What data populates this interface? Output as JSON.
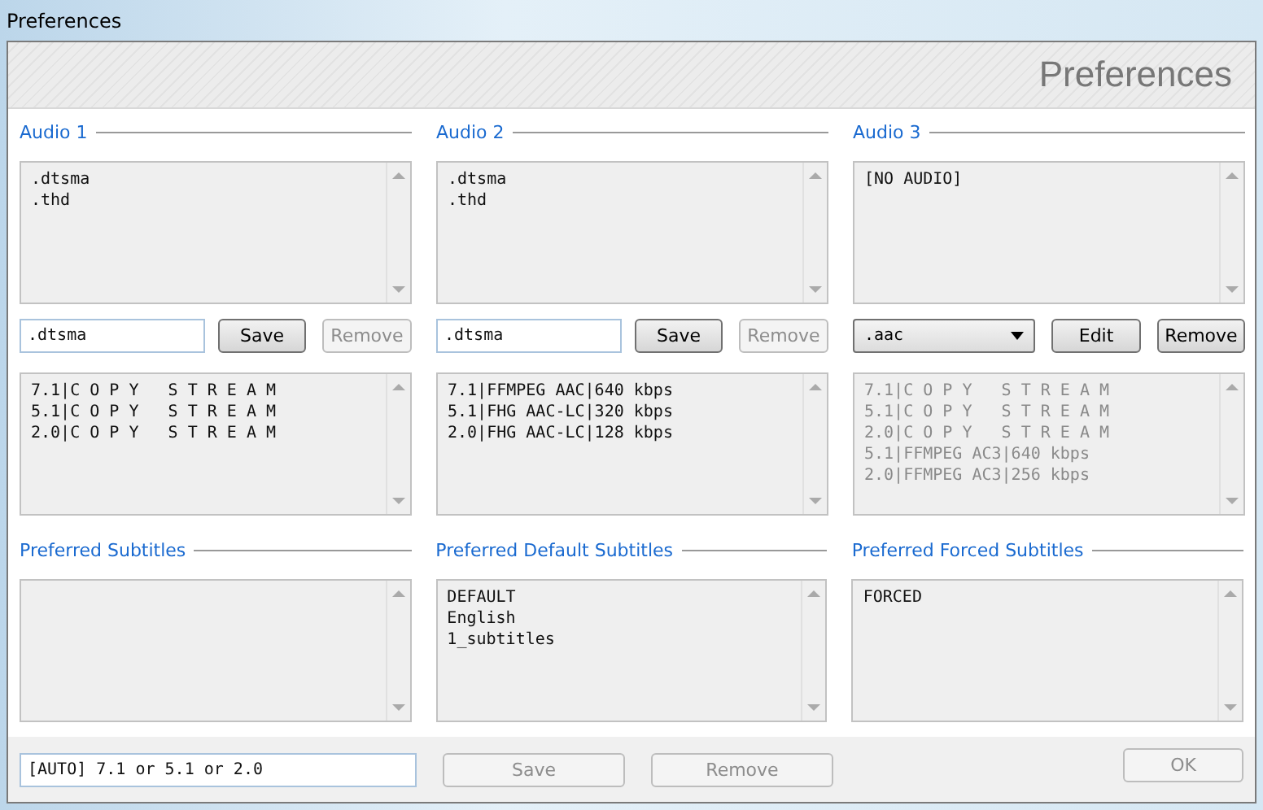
{
  "window": {
    "title": "Preferences"
  },
  "header": {
    "title": "Preferences"
  },
  "audio_sections": [
    {
      "heading": "Audio 1",
      "extensions": [
        ".dtsma",
        ".thd"
      ],
      "selector": {
        "kind": "field",
        "value": ".dtsma"
      },
      "buttons": [
        {
          "label": "Save",
          "disabled": false
        },
        {
          "label": "Remove",
          "disabled": true
        }
      ],
      "codecs": {
        "disabled": false,
        "lines": [
          "7.1|C O P Y   S T R E A M",
          "5.1|C O P Y   S T R E A M",
          "2.0|C O P Y   S T R E A M"
        ]
      }
    },
    {
      "heading": "Audio 2",
      "extensions": [
        ".dtsma",
        ".thd"
      ],
      "selector": {
        "kind": "field",
        "value": ".dtsma"
      },
      "buttons": [
        {
          "label": "Save",
          "disabled": false
        },
        {
          "label": "Remove",
          "disabled": true
        }
      ],
      "codecs": {
        "disabled": false,
        "lines": [
          "7.1|FFMPEG AAC|640 kbps",
          "5.1|FHG AAC-LC|320 kbps",
          "2.0|FHG AAC-LC|128 kbps"
        ]
      }
    },
    {
      "heading": "Audio 3",
      "extensions": [
        "[NO AUDIO]"
      ],
      "selector": {
        "kind": "dropdown",
        "value": ".aac"
      },
      "buttons": [
        {
          "label": "Edit",
          "disabled": false
        },
        {
          "label": "Remove",
          "disabled": false
        }
      ],
      "codecs": {
        "disabled": true,
        "lines": [
          "7.1|C O P Y   S T R E A M",
          "5.1|C O P Y   S T R E A M",
          "2.0|C O P Y   S T R E A M",
          "5.1|FFMPEG AC3|640 kbps",
          "2.0|FFMPEG AC3|256 kbps"
        ]
      }
    }
  ],
  "subtitle_sections": [
    {
      "heading": "Preferred Subtitles"
    },
    {
      "heading": "Preferred Default Subtitles",
      "items": [
        "DEFAULT",
        "English",
        "1_subtitles"
      ]
    },
    {
      "heading": "Preferred Forced Subtitles",
      "items": [
        "FORCED"
      ]
    }
  ],
  "footer": {
    "field": {
      "value": "[AUTO] 7.1 or 5.1 or 2.0"
    },
    "buttons": [
      {
        "label": "Save",
        "disabled": true
      },
      {
        "label": "Remove",
        "disabled": true
      }
    ],
    "ok_button": {
      "label": "OK",
      "disabled": true
    }
  }
}
